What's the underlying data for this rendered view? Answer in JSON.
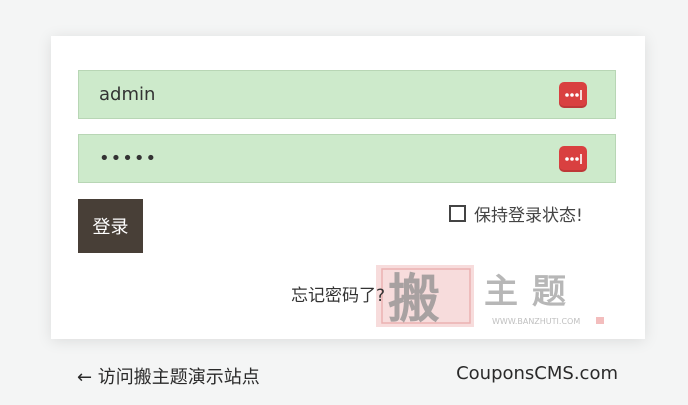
{
  "login_form": {
    "username": {
      "value": "admin",
      "icon": "password-manager-icon"
    },
    "password": {
      "value": "•••••",
      "icon": "password-manager-icon"
    },
    "submit_label": "登录",
    "remember_label": "保持登录状态!",
    "remember_checked": false,
    "forgot_label": "忘记密码了?"
  },
  "watermark": {
    "glyph": "搬",
    "text": "主 题",
    "url": "WWW.BANZHUTI.COM"
  },
  "footer": {
    "back_link": "← 访问搬主题演示站点",
    "brand": "CouponsCMS.com"
  },
  "colors": {
    "background": "#f4f5f5",
    "card": "#ffffff",
    "field_fill": "#cdeacb",
    "button": "#483f37",
    "icon_red": "#d94040"
  }
}
